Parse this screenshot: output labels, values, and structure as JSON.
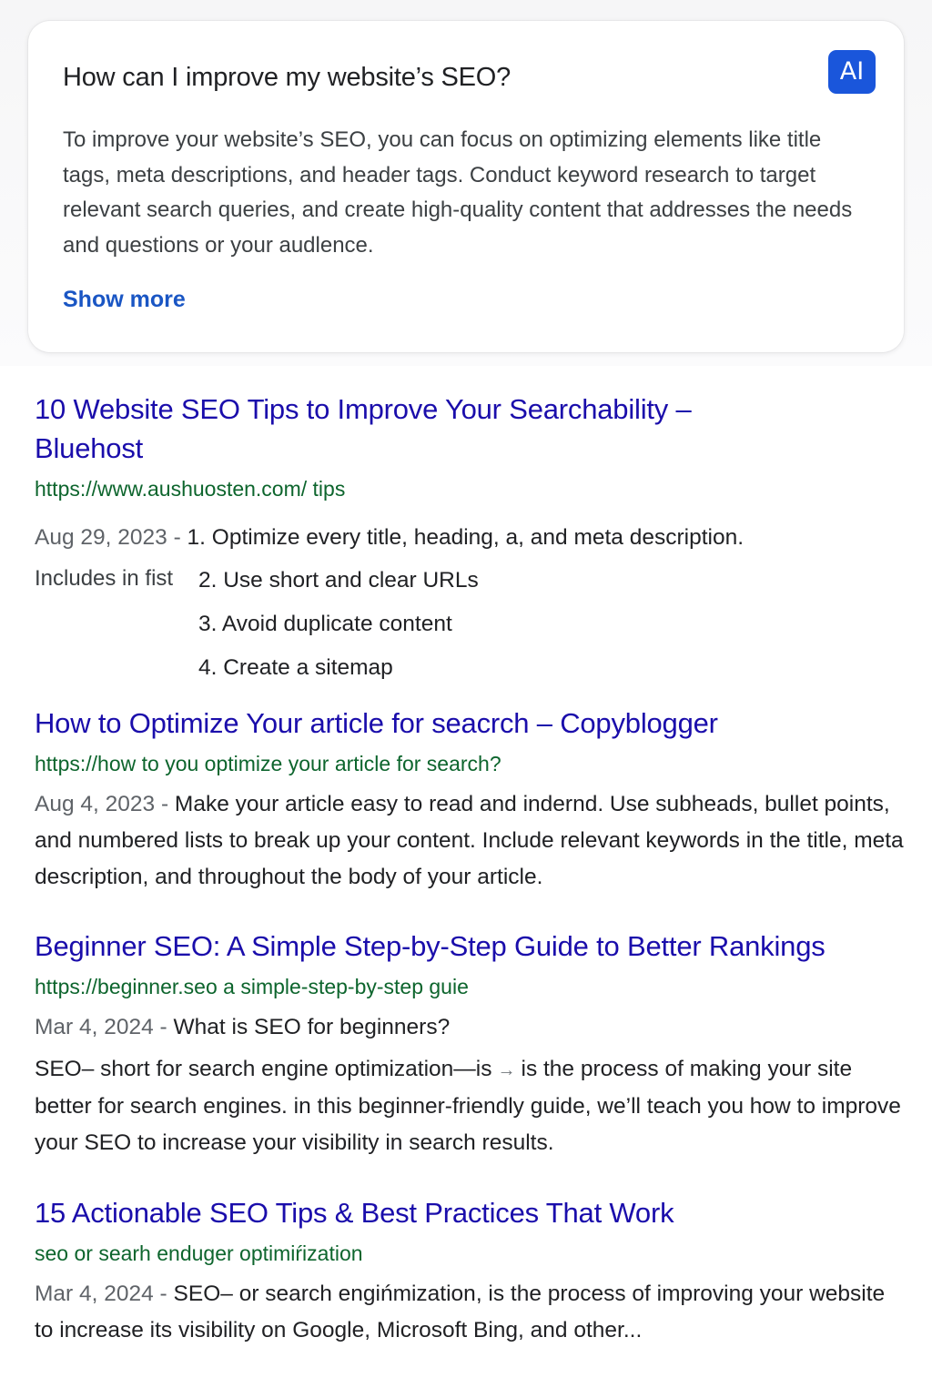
{
  "ai_overview": {
    "question": "How can I improve my website’s SEO?",
    "badge": "AI",
    "answer": "To improve your website’s SEO, you can focus on optimizing elements like title tags, meta descriptions, and header tags. Conduct keyword research to target relevant search queries, and create high-quality content that addresses the needs and questions or your audlence.",
    "show_more": "Show more"
  },
  "results": [
    {
      "title_line1": "10 Website SEO Tips to Improve Your Searchability –",
      "title_line2": "Bluehost",
      "url": "https://www.aushuosten.com/ tips",
      "date": "Aug 29, 2023 -",
      "list_label": "Includes in fist",
      "items": [
        "1. Optimize every title, heading, a, and meta description.",
        "2. Use short and clear URLs",
        "3. Avoid duplicate content",
        "4. Create a sitemap"
      ]
    },
    {
      "title": "How to Optimize Your article for seacrch – Copyblogger",
      "url": "https://how to you optimize your article for search?",
      "date": "Aug 4, 2023 -",
      "snippet": "Make your article easy to read and indernd. Use subheads, bullet points, and numbered lists to break up your content. Include relevant keywords in the title, meta description, and throughout the body of your article."
    },
    {
      "title": "Beginner SEO: A Simple Step-by-Step Guide to Better Rankings",
      "url": "https://beginner.seo a simple-step-by-step guie",
      "date": "Mar 4, 2024 -",
      "subheading": "What is SEO for beginners?",
      "snippet_start": "SEO– short for search engine optimization—is",
      "arrow": "→",
      "snippet_end": "is the process of making your site better for search engines. in this beginner-friendly guide, we’ll teach you how to improve your SEO to increase your visibility in search results."
    },
    {
      "title": "15 Actionable SEO Tips & Best Practices That Work",
      "url": "seo or searh enduger optimiŕization",
      "date": "Mar 4, 2024 -",
      "snippet": "SEO– or search engińmization, is the process of improving your website to increase its visibility on Google, Microsoft Bing, and other..."
    }
  ]
}
